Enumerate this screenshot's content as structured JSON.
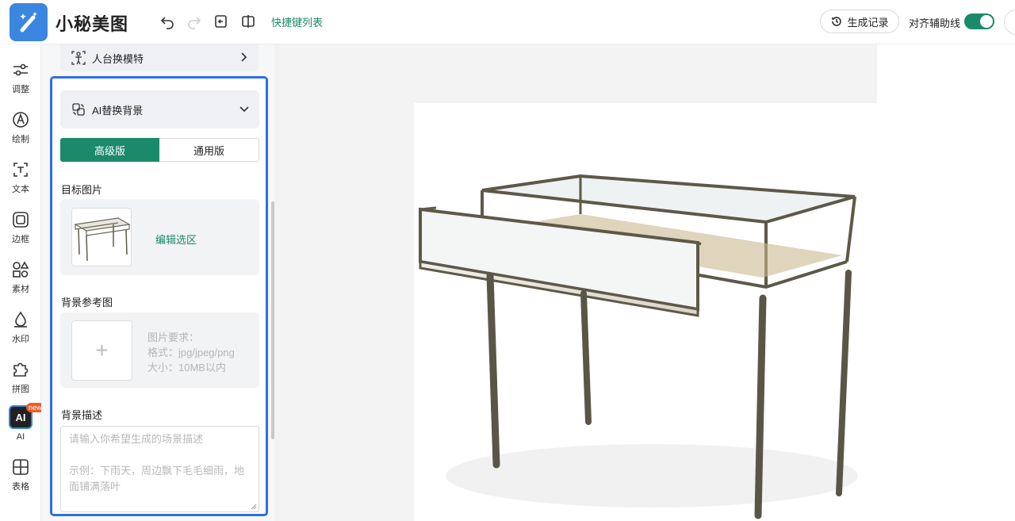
{
  "app": {
    "name": "小秘美图"
  },
  "header": {
    "shortcut_link": "快捷键列表",
    "history_button": "生成记录",
    "align_label": "对齐辅助线",
    "align_enabled": true
  },
  "nav": {
    "items": [
      {
        "label": "调整",
        "icon": "sliders-icon"
      },
      {
        "label": "绘制",
        "icon": "pen-icon"
      },
      {
        "label": "文本",
        "icon": "text-icon"
      },
      {
        "label": "边框",
        "icon": "frame-icon"
      },
      {
        "label": "素材",
        "icon": "shapes-icon"
      },
      {
        "label": "水印",
        "icon": "drop-icon"
      },
      {
        "label": "拼图",
        "icon": "puzzle-icon"
      },
      {
        "label": "AI",
        "icon": "ai-icon",
        "badge": "new",
        "active": true
      },
      {
        "label": "表格",
        "icon": "table-icon"
      }
    ]
  },
  "panel": {
    "model_row": "人台换模特",
    "section_title": "AI替换背景",
    "tabs": {
      "advanced": "高级版",
      "general": "通用版",
      "selected": "高级版"
    },
    "target_label": "目标图片",
    "edit_selection": "编辑选区",
    "bg_ref_label": "背景参考图",
    "upload_plus": "+",
    "requirements": [
      "图片要求：",
      "格式：jpg/jpeg/png",
      "大小：10MB以内"
    ],
    "bg_desc_label": "背景描述",
    "desc_placeholder_1": "请输入你希望生成的场景描述",
    "desc_placeholder_2": "示例：下雨天，周边飘下毛毛细雨，地面铺满落叶"
  },
  "colors": {
    "accent": "#1a8a6a",
    "highlight": "#2f6de8",
    "brand": "#3a86e0"
  }
}
